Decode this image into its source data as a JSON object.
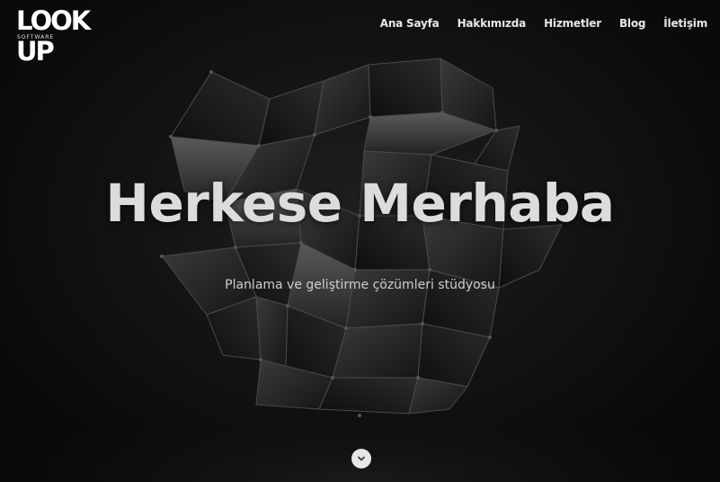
{
  "brand": {
    "logo_text": "LOOK UP",
    "logo_sub": "SOFTWARE"
  },
  "nav": {
    "items": [
      {
        "label": "Ana Sayfa"
      },
      {
        "label": "Hakkımızda"
      },
      {
        "label": "Hizmetler"
      },
      {
        "label": "Blog"
      },
      {
        "label": "İletişim"
      }
    ]
  },
  "hero": {
    "title": "Herkese Merhaba",
    "subtitle": "Planlama ve geliştirme çözümleri stüdyosu",
    "scroll_icon": "chevron-down-icon"
  },
  "colors": {
    "background": "#0c0c0c",
    "text": "#dcdcdc",
    "button": "#e6e6e6"
  }
}
